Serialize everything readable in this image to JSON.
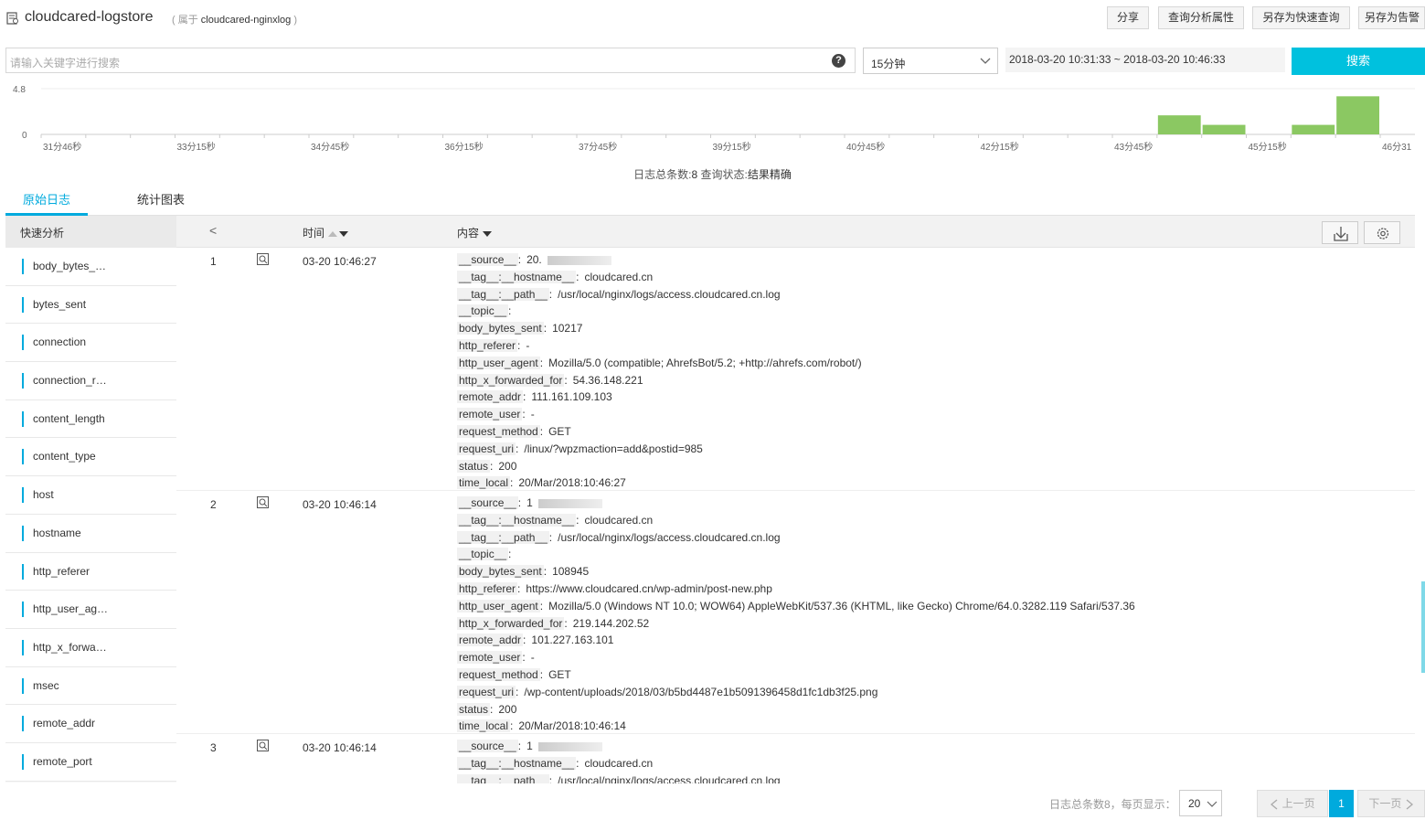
{
  "header": {
    "store_name": "cloudcared-logstore",
    "belong_prefix": "(  属于",
    "project": "cloudcared-nginxlog",
    "belong_suffix": ")",
    "buttons": [
      "分享",
      "查询分析属性",
      "另存为快速查询",
      "另存为告警"
    ]
  },
  "search": {
    "placeholder": "请输入关键字进行搜索",
    "help": "?",
    "time_preset": "15分钟",
    "time_range": "2018-03-20 10:31:33 ~ 2018-03-20 10:46:33",
    "button": "搜索"
  },
  "chart_data": {
    "type": "bar",
    "y_ticks": [
      "4.8",
      "0"
    ],
    "ylim": [
      0,
      4.8
    ],
    "x_tick_labels": [
      "31分46秒",
      "33分15秒",
      "34分45秒",
      "36分15秒",
      "37分45秒",
      "39分15秒",
      "40分45秒",
      "42分15秒",
      "43分45秒",
      "45分15秒",
      "46分31"
    ],
    "bar_color": "#8bc862",
    "bins": 30,
    "values": [
      0,
      0,
      0,
      0,
      0,
      0,
      0,
      0,
      0,
      0,
      0,
      0,
      0,
      0,
      0,
      0,
      0,
      0,
      0,
      0,
      0,
      0,
      0,
      0,
      0,
      2,
      1,
      0,
      1,
      4
    ]
  },
  "stats": {
    "prefix": "日志总条数:",
    "total": "8",
    "status_label": "  查询状态:",
    "status": "结果精确"
  },
  "tabs": [
    "原始日志",
    "统计图表"
  ],
  "sidebar": {
    "title": "快速分析",
    "items": [
      "body_bytes_…",
      "bytes_sent",
      "connection",
      "connection_r…",
      "content_length",
      "content_type",
      "host",
      "hostname",
      "http_referer",
      "http_user_ag…",
      "http_x_forwa…",
      "msec",
      "remote_addr",
      "remote_port"
    ]
  },
  "table": {
    "collapse": "<",
    "col_time": "时间",
    "col_content": "内容",
    "rows": [
      {
        "num": "1",
        "time": "03-20 10:46:27",
        "fields": [
          {
            "k": "__source__",
            "v": "20."
          },
          {
            "k": "__tag__:__hostname__",
            "v": "cloudcared.cn"
          },
          {
            "k": "__tag__:__path__",
            "v": "/usr/local/nginx/logs/access.cloudcared.cn.log"
          },
          {
            "k": "__topic__",
            "v": ""
          },
          {
            "k": "body_bytes_sent",
            "v": "10217"
          },
          {
            "k": "http_referer",
            "v": "-"
          },
          {
            "k": "http_user_agent",
            "v": "Mozilla/5.0 (compatible; AhrefsBot/5.2; +http://ahrefs.com/robot/)"
          },
          {
            "k": "http_x_forwarded_for",
            "v": "54.36.148.221"
          },
          {
            "k": "remote_addr",
            "v": "111.161.109.103"
          },
          {
            "k": "remote_user",
            "v": "-"
          },
          {
            "k": "request_method",
            "v": "GET"
          },
          {
            "k": "request_uri",
            "v": "/linux/?wpzmaction=add&postid=985"
          },
          {
            "k": "status",
            "v": "200"
          },
          {
            "k": "time_local",
            "v": "20/Mar/2018:10:46:27"
          }
        ]
      },
      {
        "num": "2",
        "time": "03-20 10:46:14",
        "fields": [
          {
            "k": "__source__",
            "v": "1"
          },
          {
            "k": "__tag__:__hostname__",
            "v": "cloudcared.cn"
          },
          {
            "k": "__tag__:__path__",
            "v": "/usr/local/nginx/logs/access.cloudcared.cn.log"
          },
          {
            "k": "__topic__",
            "v": ""
          },
          {
            "k": "body_bytes_sent",
            "v": "108945"
          },
          {
            "k": "http_referer",
            "v": "https://www.cloudcared.cn/wp-admin/post-new.php"
          },
          {
            "k": "http_user_agent",
            "v": "Mozilla/5.0 (Windows NT 10.0; WOW64) AppleWebKit/537.36 (KHTML, like Gecko) Chrome/64.0.3282.119 Safari/537.36"
          },
          {
            "k": "http_x_forwarded_for",
            "v": "219.144.202.52"
          },
          {
            "k": "remote_addr",
            "v": "101.227.163.101"
          },
          {
            "k": "remote_user",
            "v": "-"
          },
          {
            "k": "request_method",
            "v": "GET"
          },
          {
            "k": "request_uri",
            "v": "/wp-content/uploads/2018/03/b5bd4487e1b5091396458d1fc1db3f25.png"
          },
          {
            "k": "status",
            "v": "200"
          },
          {
            "k": "time_local",
            "v": "20/Mar/2018:10:46:14"
          }
        ]
      },
      {
        "num": "3",
        "time": "03-20 10:46:14",
        "fields": [
          {
            "k": "__source__",
            "v": "1"
          },
          {
            "k": "__tag__:__hostname__",
            "v": "cloudcared.cn"
          },
          {
            "k": "__tag__:__path__",
            "v": "/usr/local/nginx/logs/access.cloudcared.cn.log"
          }
        ]
      }
    ]
  },
  "pagination": {
    "summary": "日志总条数8，每页显示：",
    "page_size": "20",
    "prev": "上一页",
    "current": "1",
    "next": "下一页"
  }
}
